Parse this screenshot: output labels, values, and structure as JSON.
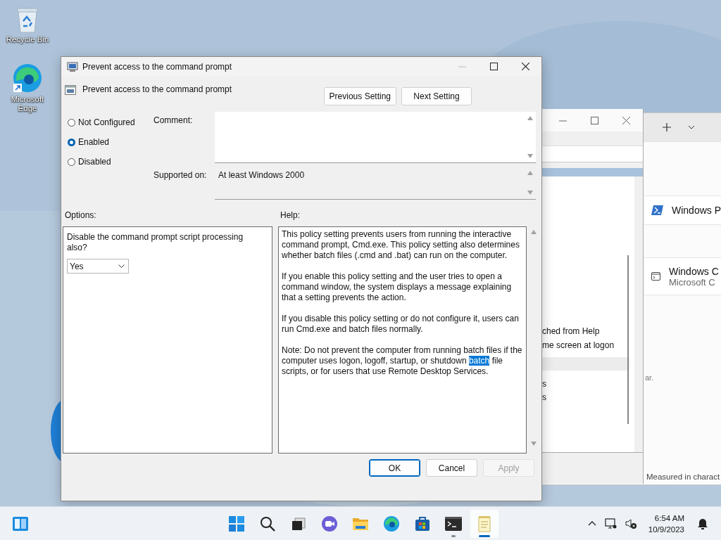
{
  "desktop_icons": [
    {
      "kind": "recycle",
      "label": "Recycle Bin"
    },
    {
      "kind": "edge",
      "label": "Microsoft Edge"
    }
  ],
  "terminal_window": {
    "profiles": [
      {
        "kind": "powershell",
        "title": "Windows P"
      },
      {
        "kind": "console",
        "title": "Windows C",
        "subtitle": "Microsoft C"
      }
    ],
    "note": "ar.",
    "footer": "Measured in charact"
  },
  "editor_window": {
    "lines": [
      "ched from Help",
      "me screen at logon"
    ],
    "list_items": [
      {
        "text": "s"
      },
      {
        "text": "s"
      }
    ]
  },
  "dialog": {
    "title": "Prevent access to the command prompt",
    "policy_title": "Prevent access to the command prompt",
    "nav_buttons": [
      "Previous Setting",
      "Next Setting"
    ],
    "states": [
      {
        "label": "Not Configured",
        "selected": false
      },
      {
        "label": "Enabled",
        "selected": true
      },
      {
        "label": "Disabled",
        "selected": false
      }
    ],
    "comment_label": "Comment:",
    "supported_label": "Supported on:",
    "supported_value": "At least Windows 2000",
    "options_label": "Options:",
    "help_label": "Help:",
    "option_text": "Disable the command prompt script processing also?",
    "option_value": "Yes",
    "help_paragraphs": [
      {
        "text": "This policy setting prevents users from running the interactive command prompt, Cmd.exe.  This policy setting also determines whether batch files (.cmd and .bat) can run on the computer."
      },
      {
        "text": "If you enable this policy setting and the user tries to open a command window, the system displays a message explaining that a setting prevents the action."
      },
      {
        "text": "If you disable this policy setting or do not configure it, users can run Cmd.exe and batch files normally."
      },
      {
        "text": "Note: Do not prevent the computer from running batch files if the computer uses logon, logoff, startup, or shutdown ",
        "selected_text": "batch",
        "text_after": " file scripts, or for users that use Remote Desktop Services."
      }
    ],
    "buttons": [
      {
        "label": "OK",
        "default": true,
        "disabled": false
      },
      {
        "label": "Cancel",
        "default": false,
        "disabled": false
      },
      {
        "label": "Apply",
        "default": false,
        "disabled": true
      }
    ]
  },
  "taskbar": {
    "apps": [
      {
        "kind": "start",
        "running": false,
        "active": false
      },
      {
        "kind": "search",
        "running": false,
        "active": false
      },
      {
        "kind": "taskview",
        "running": false,
        "active": false
      },
      {
        "kind": "chat",
        "running": false,
        "active": false
      },
      {
        "kind": "explorer",
        "running": false,
        "active": false
      },
      {
        "kind": "edge",
        "running": false,
        "active": false
      },
      {
        "kind": "store",
        "running": false,
        "active": false
      },
      {
        "kind": "terminal",
        "running": true,
        "active": false
      },
      {
        "kind": "notepad",
        "running": true,
        "active": true
      }
    ],
    "time": "6:54 AM",
    "date": "10/9/2023"
  }
}
